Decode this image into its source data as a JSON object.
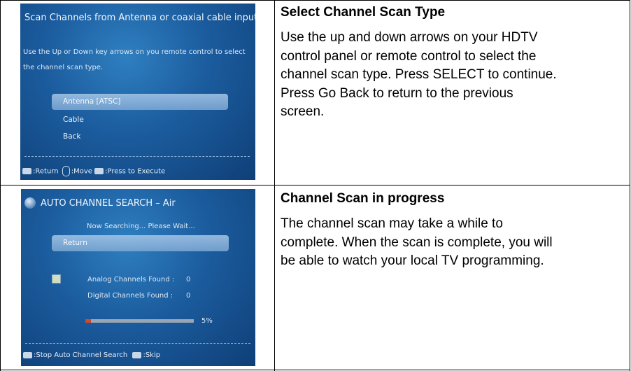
{
  "rows": [
    {
      "screen": {
        "title": "Scan Channels from Antenna or coaxial cable input",
        "instruction_line1": "Use the Up or Down key arrows on you remote control to select",
        "instruction_line2": "the channel scan type.",
        "options": [
          "Antenna [ATSC]",
          "Cable",
          "Back"
        ],
        "selected_index": 0,
        "footer": {
          "return_label": ":Return",
          "move_label": ":Move",
          "execute_label": ":Press to Execute"
        }
      },
      "heading": "Select Channel Scan Type",
      "description_lines": [
        "Use the up and down arrows on your HDTV",
        "control panel or remote control to select the",
        "channel scan type. Press SELECT to continue.",
        "Press Go Back to return to the previous",
        "screen."
      ]
    },
    {
      "screen": {
        "title": "AUTO CHANNEL SEARCH – Air",
        "status": "Now Searching... Please Wait...",
        "return_label": "Return",
        "analog_label": "Analog Channels Found :",
        "analog_value": "0",
        "digital_label": "Digital Channels Found :",
        "digital_value": "0",
        "progress_text": "5%",
        "progress_fraction": 0.05,
        "footer": {
          "stop_label": ":Stop Auto Channel Search",
          "skip_label": ":Skip"
        }
      },
      "heading": "Channel Scan in progress",
      "description_lines": [
        "The channel scan may take a while to",
        "complete. When the scan is complete, you will",
        "be able to watch your local TV programming."
      ]
    }
  ]
}
